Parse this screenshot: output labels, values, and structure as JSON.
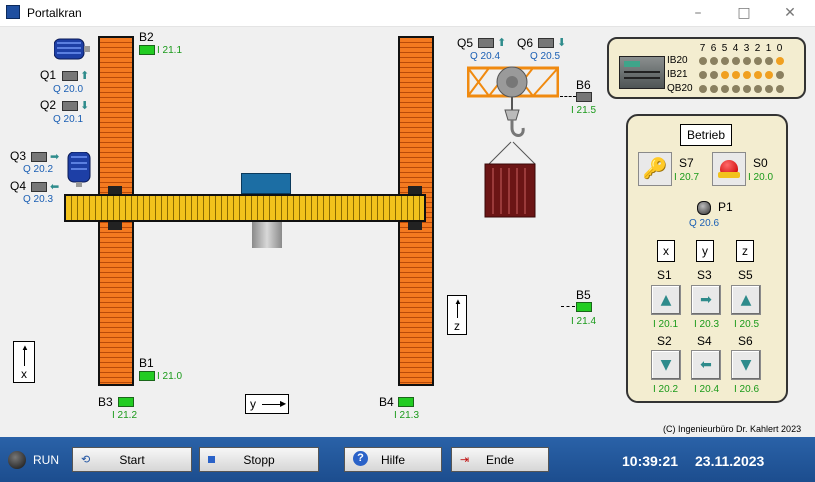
{
  "window": {
    "title": "Portalkran",
    "minimize": "–",
    "maximize": "□",
    "close": "✕"
  },
  "motors": {
    "x_motor": {
      "name": "B2",
      "addr": "I 21.1"
    },
    "q1": {
      "label": "Q1",
      "addr": "Q 20.0"
    },
    "q2": {
      "label": "Q2",
      "addr": "Q 20.1"
    },
    "q3": {
      "label": "Q3",
      "addr": "Q 20.2"
    },
    "q4": {
      "label": "Q4",
      "addr": "Q 20.3"
    },
    "q5": {
      "label": "Q5",
      "addr": "Q 20.4"
    },
    "q6": {
      "label": "Q6",
      "addr": "Q 20.5"
    }
  },
  "sensors": {
    "b1": {
      "label": "B1",
      "addr": "I 21.0"
    },
    "b2": {
      "label": "B2",
      "addr": "I 21.1"
    },
    "b3": {
      "label": "B3",
      "addr": "I 21.2"
    },
    "b4": {
      "label": "B4",
      "addr": "I 21.3"
    },
    "b5": {
      "label": "B5",
      "addr": "I 21.4"
    },
    "b6": {
      "label": "B6",
      "addr": "I 21.5"
    }
  },
  "axes": {
    "x": "x",
    "y": "y",
    "z": "z"
  },
  "plc": {
    "bits": [
      "7",
      "6",
      "5",
      "4",
      "3",
      "2",
      "1",
      "0"
    ],
    "rows": [
      {
        "label": "IB20",
        "leds": [
          0,
          0,
          0,
          0,
          0,
          0,
          0,
          1
        ]
      },
      {
        "label": "IB21",
        "leds": [
          0,
          0,
          1,
          1,
          1,
          1,
          1,
          0
        ]
      },
      {
        "label": "QB20",
        "leds": [
          0,
          0,
          0,
          0,
          0,
          0,
          0,
          0
        ]
      }
    ],
    "led_on_color": "#f0a020",
    "led_off_color": "#8a8060"
  },
  "control": {
    "mode_button": "Betrieb",
    "s7": {
      "label": "S7",
      "addr": "I 20.7"
    },
    "s0": {
      "label": "S0",
      "addr": "I 20.0"
    },
    "p1": {
      "label": "P1",
      "addr": "Q 20.6"
    },
    "axis_x": "x",
    "axis_y": "y",
    "axis_z": "z",
    "s1": {
      "label": "S1",
      "addr": "I 20.1",
      "icon": "▲"
    },
    "s3": {
      "label": "S3",
      "addr": "I 20.3",
      "icon": "➡"
    },
    "s5": {
      "label": "S5",
      "addr": "I 20.5",
      "icon": "▲"
    },
    "s2": {
      "label": "S2",
      "addr": "I 20.2",
      "icon": "▼"
    },
    "s4": {
      "label": "S4",
      "addr": "I 20.4",
      "icon": "⬅"
    },
    "s6": {
      "label": "S6",
      "addr": "I 20.6",
      "icon": "▼"
    }
  },
  "copyright": "(C) Ingenieurbüro Dr. Kahlert 2023",
  "statusbar": {
    "run_label": "RUN",
    "start": "Start",
    "stop": "Stopp",
    "help": "Hilfe",
    "end": "Ende",
    "time": "10:39:21",
    "date": "23.11.2023"
  }
}
